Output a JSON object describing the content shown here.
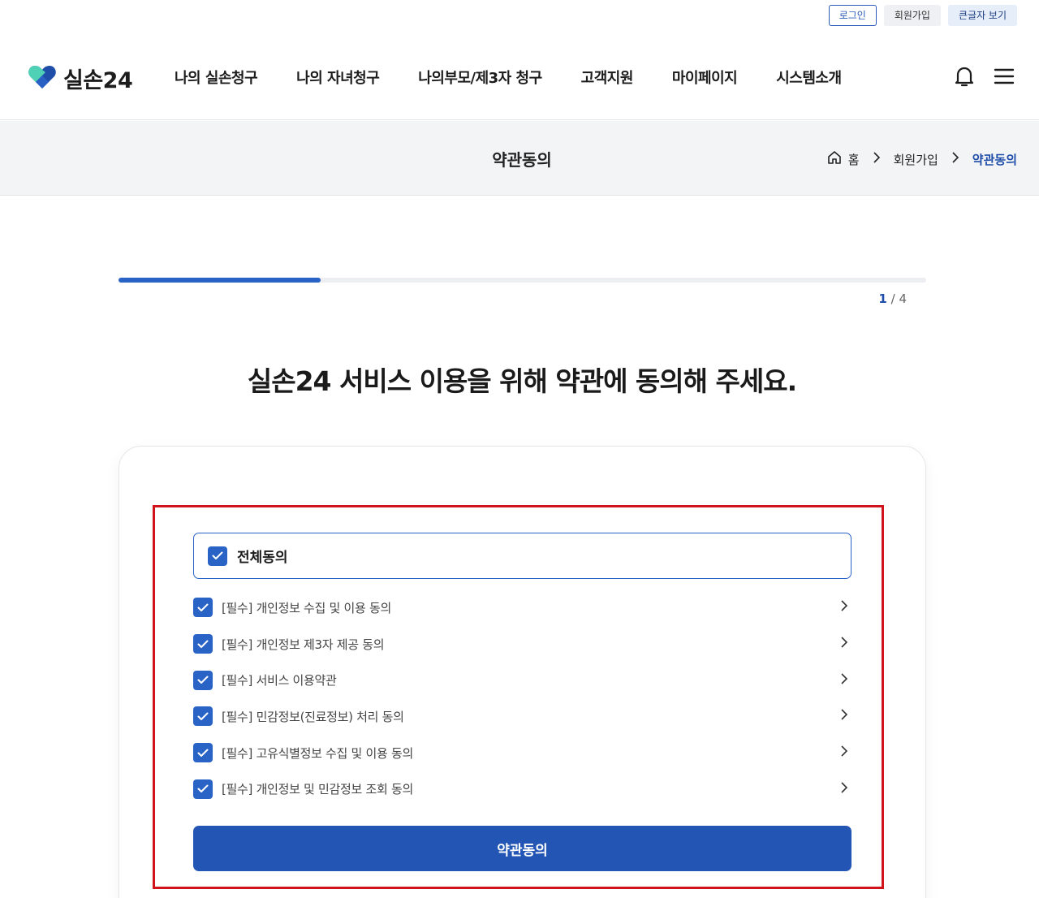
{
  "utility": {
    "login": "로그인",
    "join": "회원가입",
    "large_text": "큰글자 보기"
  },
  "brand": {
    "name": "실손24",
    "logo_icon": "heart-logo-icon",
    "colors": {
      "primary": "#2356b4",
      "accent": "#2a63c6",
      "logo_teal": "#4fd1b5",
      "logo_navy": "#1f4ea8",
      "highlight_border": "#d0121b"
    }
  },
  "nav": {
    "items": [
      {
        "label": "나의 실손청구"
      },
      {
        "label": "나의 자녀청구"
      },
      {
        "label": "나의부모/제3자 청구"
      },
      {
        "label": "고객지원"
      },
      {
        "label": "마이페이지"
      },
      {
        "label": "시스템소개"
      }
    ],
    "icons": [
      "bell-icon",
      "hamburger-menu-icon"
    ]
  },
  "subbar": {
    "title": "약관동의",
    "breadcrumb": {
      "home": "홈",
      "level1": "회원가입",
      "current": "약관동의"
    }
  },
  "progress": {
    "current_step": "1",
    "separator": " / ",
    "total_steps": "4",
    "fraction": 0.25
  },
  "headline": "실손24 서비스 이용을 위해 약관에 동의해 주세요.",
  "agreement": {
    "all_label": "전체동의",
    "all_checked": true,
    "terms": [
      {
        "label": "[필수] 개인정보 수집 및 이용 동의",
        "checked": true
      },
      {
        "label": "[필수] 개인정보 제3자 제공 동의",
        "checked": true
      },
      {
        "label": "[필수] 서비스 이용약관",
        "checked": true
      },
      {
        "label": "[필수] 민감정보(진료정보) 처리 동의",
        "checked": true
      },
      {
        "label": "[필수] 고유식별정보 수집 및 이용 동의",
        "checked": true
      },
      {
        "label": "[필수] 개인정보 및 민감정보 조회 동의",
        "checked": true
      }
    ],
    "submit_label": "약관동의"
  }
}
